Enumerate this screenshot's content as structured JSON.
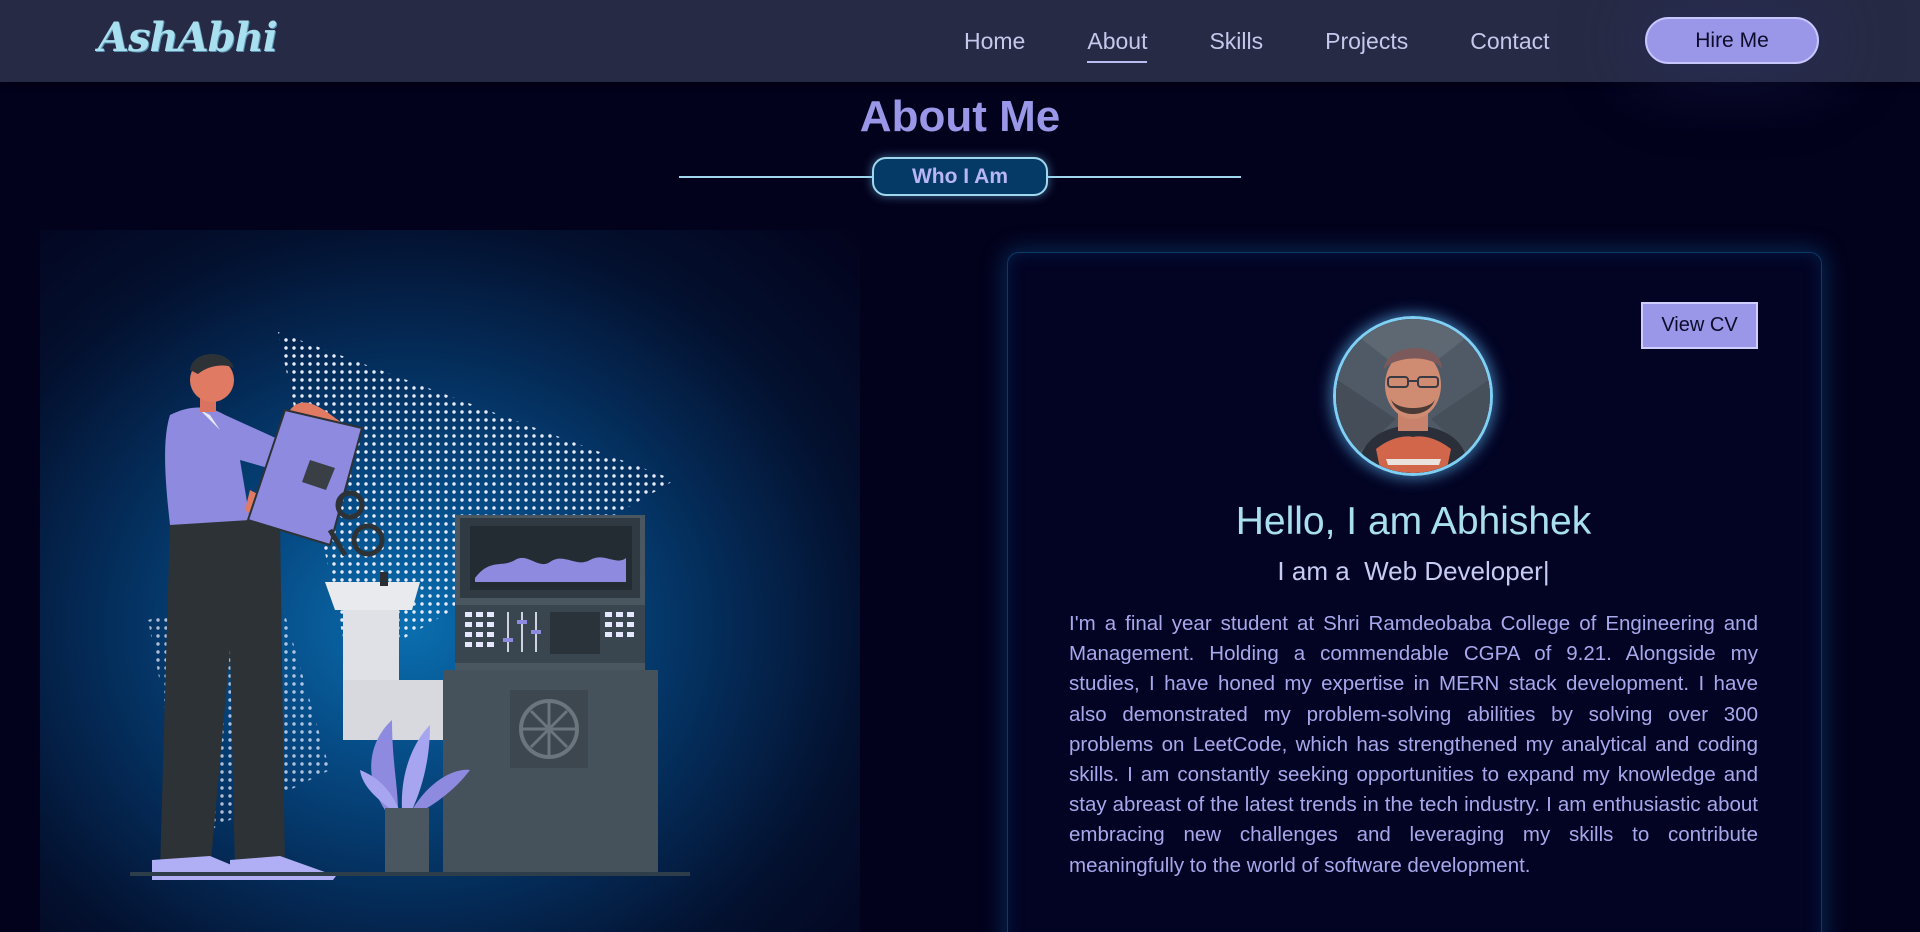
{
  "nav": {
    "logo": "AshAbhi",
    "links": [
      "Home",
      "About",
      "Skills",
      "Projects",
      "Contact"
    ],
    "active": "About",
    "hire_label": "Hire Me"
  },
  "section": {
    "title": "About Me",
    "subtitle": "Who I Am"
  },
  "card": {
    "view_cv_label": "View CV",
    "greeting": "Hello, I am Abhishek",
    "role_line": "I am a  Web Developer|",
    "bio": "I'm a final year student at Shri Ramdeobaba College of Engineering and Management. Holding a commendable CGPA of 9.21. Alongside my studies, I have honed my expertise in MERN stack development. I have also demonstrated my problem-solving abilities by solving over 300 problems on LeetCode, which has strengthened my analytical and coding skills. I am constantly seeking opportunities to expand my knowledge and stay abreast of the latest trends in the tech industry. I am enthusiastic about embracing new challenges and leveraging my skills to contribute meaningfully to the world of software development."
  },
  "colors": {
    "background": "#03021c",
    "navbar": "#272a44",
    "accent": "#9a96e8",
    "cyan": "#a8e0f0"
  }
}
